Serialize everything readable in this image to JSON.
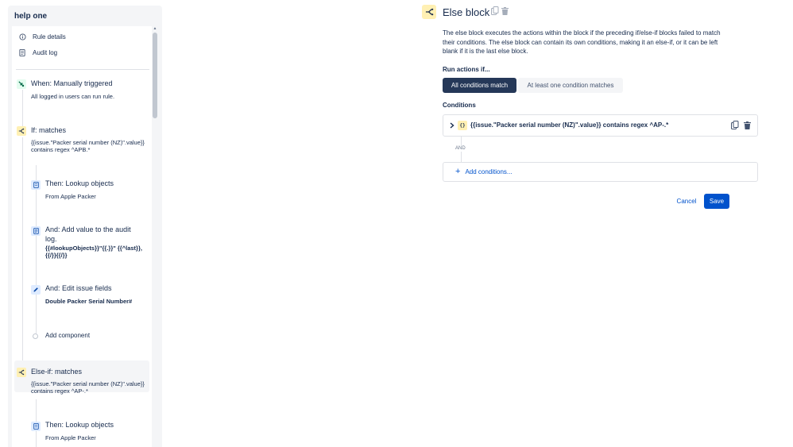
{
  "rule": {
    "title": "help one"
  },
  "nav": {
    "items": [
      {
        "label": "Rule details",
        "icon": "info-icon"
      },
      {
        "label": "Audit log",
        "icon": "document-icon"
      }
    ]
  },
  "components": [
    {
      "title": "When: Manually triggered",
      "subtitle": "All logged in users can run rule.",
      "icon": "trigger-icon",
      "color": "#e3fcef"
    },
    {
      "title": "If: matches",
      "subtitle": "{{issue.\"Packer serial number (NZ)\".value}} contains regex ^APB.*",
      "icon": "branch-icon",
      "color": "#fff0b3"
    },
    {
      "title": "Then: Lookup objects",
      "subtitle": "From Apple Packer",
      "icon": "lookup-icon",
      "color": "#deebff"
    },
    {
      "title": "And: Add value to the audit log.",
      "subtitle": "{{#lookupObjects}}\"{{.}}\" {{^last}}, {{/}}{{/}}",
      "icon": "audit-icon",
      "color": "#deebff"
    },
    {
      "title": "And: Edit issue fields",
      "subtitle": "Double Packer Serial Number#",
      "icon": "edit-icon",
      "color": "#deebff"
    },
    {
      "title": "Add component",
      "icon": "add-circle-icon"
    },
    {
      "title": "Else-if: matches",
      "subtitle": "{{issue.\"Packer serial number (NZ)\".value}} contains regex ^AP-.*",
      "icon": "branch-icon",
      "color": "#fff0b3"
    },
    {
      "title": "Then: Lookup objects",
      "subtitle": "From Apple Packer",
      "icon": "lookup-icon",
      "color": "#deebff"
    }
  ],
  "editor": {
    "title": "Else block",
    "description": "The else block executes the actions within the block if the preceding if/else-if blocks failed to match their conditions. The else block can contain its own conditions, making it an else-if, or it can be left blank if it is the last else block.",
    "run_label": "Run actions if...",
    "toggle_all": "All conditions match",
    "toggle_any": "At least one condition matches",
    "conditions_label": "Conditions",
    "condition_icon": "{}",
    "condition_text": "{{issue.\"Packer serial number (NZ)\".value}} contains regex ^AP-.*",
    "and_label": "AND",
    "add_conditions": "Add conditions...",
    "cancel": "Cancel",
    "save": "Save"
  },
  "colors": {
    "accent": "#0052cc",
    "toggle_active": "#253858",
    "condition_yellow": "#fff0b3"
  }
}
